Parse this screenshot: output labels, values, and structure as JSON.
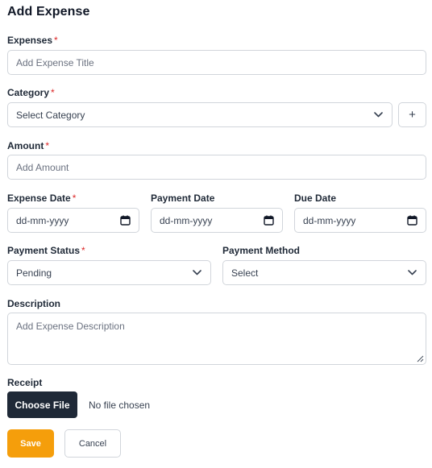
{
  "form": {
    "title": "Add Expense",
    "required_mark": "*",
    "expense": {
      "label": "Expenses",
      "placeholder": "Add Expense Title"
    },
    "category": {
      "label": "Category",
      "value": "Select Category",
      "add_label": "+"
    },
    "amount": {
      "label": "Amount",
      "placeholder": "Add Amount"
    },
    "expense_date": {
      "label": "Expense Date",
      "value": "dd-mm-yyyy"
    },
    "payment_date": {
      "label": "Payment Date",
      "value": "dd-mm-yyyy"
    },
    "due_date": {
      "label": "Due Date",
      "value": "dd-mm-yyyy"
    },
    "payment_status": {
      "label": "Payment Status",
      "value": "Pending"
    },
    "payment_method": {
      "label": "Payment Method",
      "value": "Select"
    },
    "description": {
      "label": "Description",
      "placeholder": "Add Expense Description"
    },
    "receipt": {
      "label": "Receipt",
      "button_label": "Choose File",
      "status": "No file chosen"
    },
    "actions": {
      "save_label": "Save",
      "cancel_label": "Cancel"
    }
  },
  "icons": {
    "dropdown": "chevron-down-icon",
    "calendar": "calendar-icon",
    "add": "plus-icon",
    "resize": "resize-grip-icon"
  },
  "colors": {
    "primary_action": "#f59e0b",
    "dark_button": "#1f2937",
    "required": "#dc2626",
    "border": "#d1d5db"
  }
}
